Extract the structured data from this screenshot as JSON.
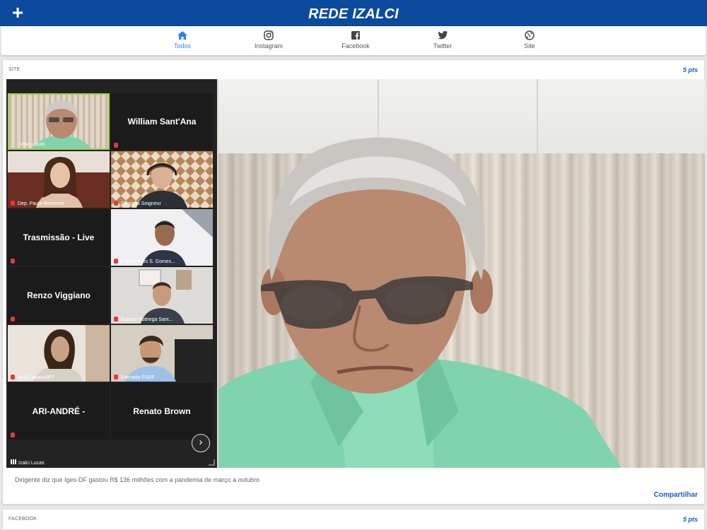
{
  "header": {
    "title": "REDE IZALCI",
    "add_icon": "plus-icon"
  },
  "tabs": [
    {
      "label": "Todos",
      "icon": "home-icon",
      "active": true
    },
    {
      "label": "Instagram",
      "icon": "instagram-icon",
      "active": false
    },
    {
      "label": "Facebook",
      "icon": "facebook-icon",
      "active": false
    },
    {
      "label": "Twitter",
      "icon": "twitter-icon",
      "active": false
    },
    {
      "label": "Site",
      "icon": "globe-icon",
      "active": false
    }
  ],
  "post": {
    "source": "SITE",
    "points": "5 pts",
    "caption": "Dirigente diz que Iges-DF gastou R$ 136 milhões com a pandemia de março a outubro",
    "share_label": "Compartilhar",
    "video": {
      "participants": [
        {
          "name": "Izalci Lucas",
          "kind": "video"
        },
        {
          "name": "William Sant'Ana",
          "kind": "name"
        },
        {
          "name": "Dep. Paula Belmonte",
          "kind": "video"
        },
        {
          "name": "Georges Seigneur",
          "kind": "video"
        },
        {
          "name": "Trasmissão - Live",
          "kind": "name"
        },
        {
          "name": "Dickson dos S. Gomes...",
          "kind": "video"
        },
        {
          "name": "Renzo Viggiano",
          "kind": "name"
        },
        {
          "name": "Ramiro Nóbrega Sant...",
          "kind": "video"
        },
        {
          "name": "Ana ClaudiaMPT",
          "kind": "video"
        },
        {
          "name": "Everaldo FSDF",
          "kind": "video"
        },
        {
          "name": "ARI-ANDRÉ -",
          "kind": "name"
        },
        {
          "name": "Renato Brown",
          "kind": "name"
        }
      ],
      "active_speaker": "Izalci Lucas"
    }
  },
  "post2": {
    "source": "FACEBOOK",
    "points": "5 pts"
  },
  "colors": {
    "brand": "#0c4a9e",
    "accent": "#2f80ed",
    "link": "#1e5bb8"
  }
}
